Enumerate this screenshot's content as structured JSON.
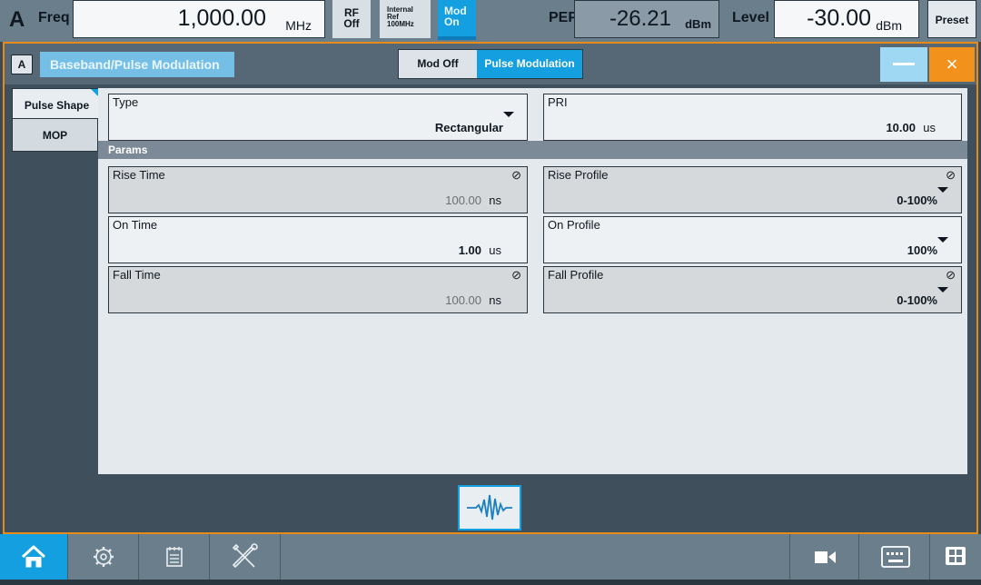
{
  "status_bar": {
    "channel": "A",
    "freq_label": "Freq",
    "freq_value": "1,000.00",
    "freq_unit": "MHz",
    "rf_line1": "RF",
    "rf_line2": "Off",
    "ref_line1": "Internal",
    "ref_line2": "Ref",
    "ref_line3": "100MHz",
    "mod_line1": "Mod",
    "mod_line2": "On",
    "pep_label": "PEP",
    "pep_value": "-26.21",
    "pep_unit": "dBm",
    "level_label": "Level",
    "level_value": "-30.00",
    "level_unit": "dBm",
    "preset_label": "Preset"
  },
  "dialog": {
    "channel": "A",
    "title": "Baseband/Pulse Modulation",
    "mod_off_label": "Mod Off",
    "pulse_mod_label": "Pulse Modulation",
    "close_symbol": "×",
    "tabs": [
      {
        "label": "Pulse Shape",
        "selected": true
      },
      {
        "label": "MOP",
        "selected": false
      }
    ],
    "type": {
      "label": "Type",
      "value": "Rectangular"
    },
    "pri": {
      "label": "PRI",
      "value": "10.00",
      "unit": "us"
    },
    "params_header": "Params",
    "rise_time": {
      "label": "Rise Time",
      "value": "100.00",
      "unit": "ns",
      "read_only": true
    },
    "rise_profile": {
      "label": "Rise Profile",
      "value": "0-100%",
      "read_only": true
    },
    "on_time": {
      "label": "On Time",
      "value": "1.00",
      "unit": "us"
    },
    "on_profile": {
      "label": "On Profile",
      "value": "100%"
    },
    "fall_time": {
      "label": "Fall Time",
      "value": "100.00",
      "unit": "ns",
      "read_only": true
    },
    "fall_profile": {
      "label": "Fall Profile",
      "value": "0-100%",
      "read_only": true
    }
  },
  "taskbar": {
    "icons": [
      "home-icon",
      "settings-icon",
      "setup-icon",
      "tools-icon",
      "video-icon",
      "keyboard-icon",
      "windows-icon"
    ]
  },
  "colors": {
    "accent": "#139fe0",
    "close_orange": "#f2921d",
    "dialog_border": "#e68a1a"
  }
}
